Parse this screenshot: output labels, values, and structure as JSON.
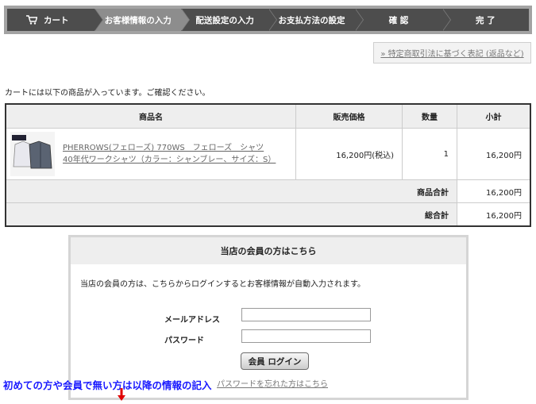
{
  "steps": [
    "カート",
    "お客様情報の入力",
    "配送設定の入力",
    "お支払方法の設定",
    "確 認",
    "完 了"
  ],
  "legal_link": "» 特定商取引法に基づく表記 (返品など)",
  "notice": "カートには以下の商品が入っています。ご確認ください。",
  "table": {
    "headers": [
      "商品名",
      "販売価格",
      "数量",
      "小計"
    ],
    "item": {
      "name_line1": "PHERROWS(フェローズ) 770WS　フェローズ　シャツ",
      "name_line2": "40年代ワークシャツ（カラー：シャンブレー、サイズ：S）",
      "price": "16,200円(税込)",
      "qty": "1",
      "subtotal": "16,200円"
    },
    "product_total_label": "商品合計",
    "product_total": "16,200円",
    "grand_total_label": "総合計",
    "grand_total": "16,200円"
  },
  "login": {
    "title": "当店の会員の方はこちら",
    "description": "当店の会員の方は、こちらからログインするとお客様情報が自動入力されます。",
    "email_label": "メールアドレス",
    "email_value": "",
    "password_label": "パスワード",
    "password_value": "",
    "button": "会員 ログイン",
    "forgot": "パスワードを忘れた方はこちら"
  },
  "overlay_note": "初めての方や会員で無い方は以降の情報の記入",
  "colors": {
    "step_bg": "#4d4d4d",
    "step_active": "#8d8d8d",
    "note": "#1a1aff",
    "arrow": "#e00000"
  }
}
